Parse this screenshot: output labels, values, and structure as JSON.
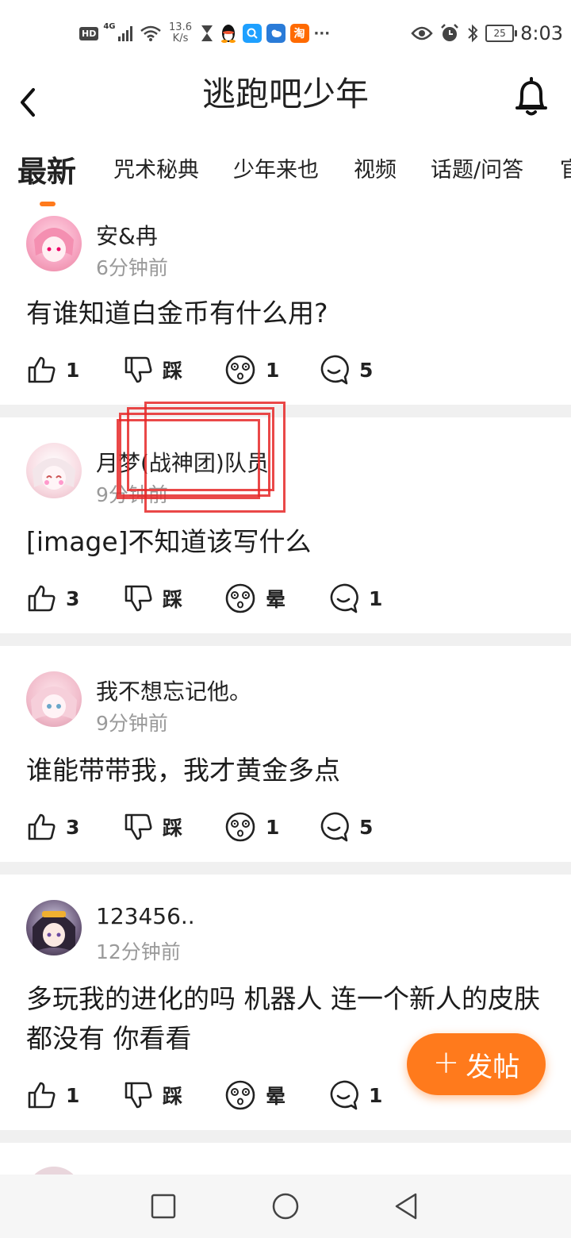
{
  "status_bar": {
    "hd": "HD",
    "signal_tech": "4G",
    "net_speed_value": "13.6",
    "net_speed_unit": "K/s",
    "taobao_icon_text": "淘",
    "more": "···",
    "battery": "25",
    "time": "8:03"
  },
  "header": {
    "title": "逃跑吧少年"
  },
  "tabs": [
    {
      "label": "最新",
      "active": true
    },
    {
      "label": "咒术秘典"
    },
    {
      "label": "少年来也"
    },
    {
      "label": "视频"
    },
    {
      "label": "话题/问答"
    },
    {
      "label": "官"
    }
  ],
  "posts": [
    {
      "author": "安&冉",
      "time": "6分钟前",
      "content": "有谁知道白金币有什么用?",
      "likes": "1",
      "dislike_label": "踩",
      "reaction": "1",
      "comments": "5"
    },
    {
      "author": "月梦(战神团)队员",
      "time": "9分钟前",
      "content": "[image]不知道该写什么",
      "likes": "3",
      "dislike_label": "踩",
      "reaction": "晕",
      "comments": "1"
    },
    {
      "author": "我不想忘记他。",
      "time": "9分钟前",
      "content": "谁能带带我，我才黄金多点",
      "likes": "3",
      "dislike_label": "踩",
      "reaction": "1",
      "comments": "5"
    },
    {
      "author": "123456..",
      "time": "12分钟前",
      "content": "多玩我的进化的吗 机器人 连一个新人的皮肤都没有 你看看",
      "likes": "1",
      "dislike_label": "踩",
      "reaction": "晕",
      "comments": "1"
    }
  ],
  "fab": {
    "plus": "+",
    "label": "发帖"
  },
  "colors": {
    "accent": "#ff7a1c",
    "annotation": "#e62828",
    "separator": "#f0f0f0",
    "muted_text": "#9a9a9a"
  }
}
